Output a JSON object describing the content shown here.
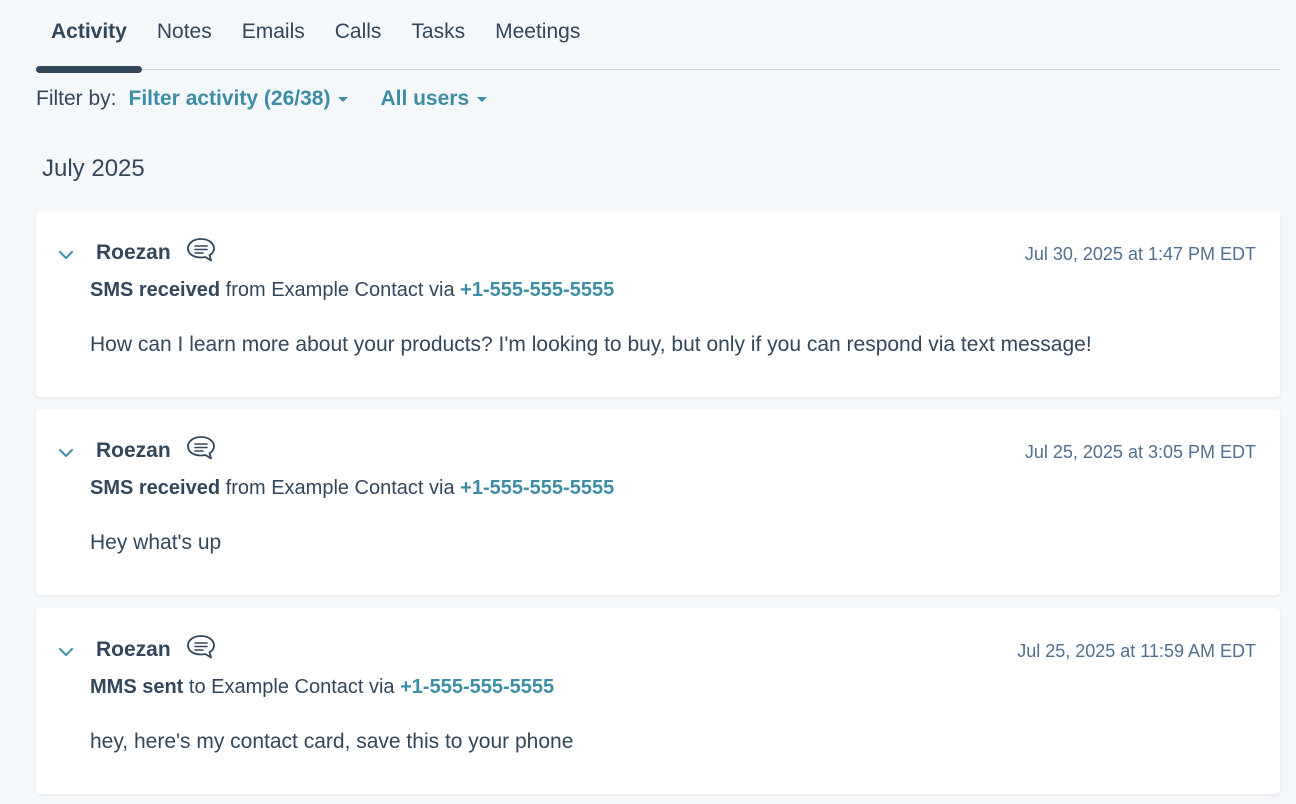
{
  "tabs": [
    {
      "label": "Activity"
    },
    {
      "label": "Notes"
    },
    {
      "label": "Emails"
    },
    {
      "label": "Calls"
    },
    {
      "label": "Tasks"
    },
    {
      "label": "Meetings"
    }
  ],
  "filter": {
    "label": "Filter by:",
    "activity": "Filter activity (26/38)",
    "users": "All users"
  },
  "month": "July 2025",
  "activities": [
    {
      "author": "Roezan",
      "timestamp": "Jul 30, 2025 at 1:47 PM EDT",
      "action": "SMS received",
      "connector": " from Example Contact via ",
      "phone": "+1-555-555-5555",
      "body": "How can I learn more about your products? I'm looking to buy, but only if you can respond via text message!"
    },
    {
      "author": "Roezan",
      "timestamp": "Jul 25, 2025 at 3:05 PM EDT",
      "action": "SMS received",
      "connector": " from Example Contact via ",
      "phone": "+1-555-555-5555",
      "body": "Hey what's up"
    },
    {
      "author": "Roezan",
      "timestamp": "Jul 25, 2025 at 11:59 AM EDT",
      "action": "MMS sent",
      "connector": " to Example Contact via ",
      "phone": "+1-555-555-5555",
      "body": "hey, here's my contact card, save this to your phone"
    }
  ],
  "colors": {
    "accent": "#3d8ea5",
    "text": "#33475b",
    "background": "#f5f8fa"
  }
}
